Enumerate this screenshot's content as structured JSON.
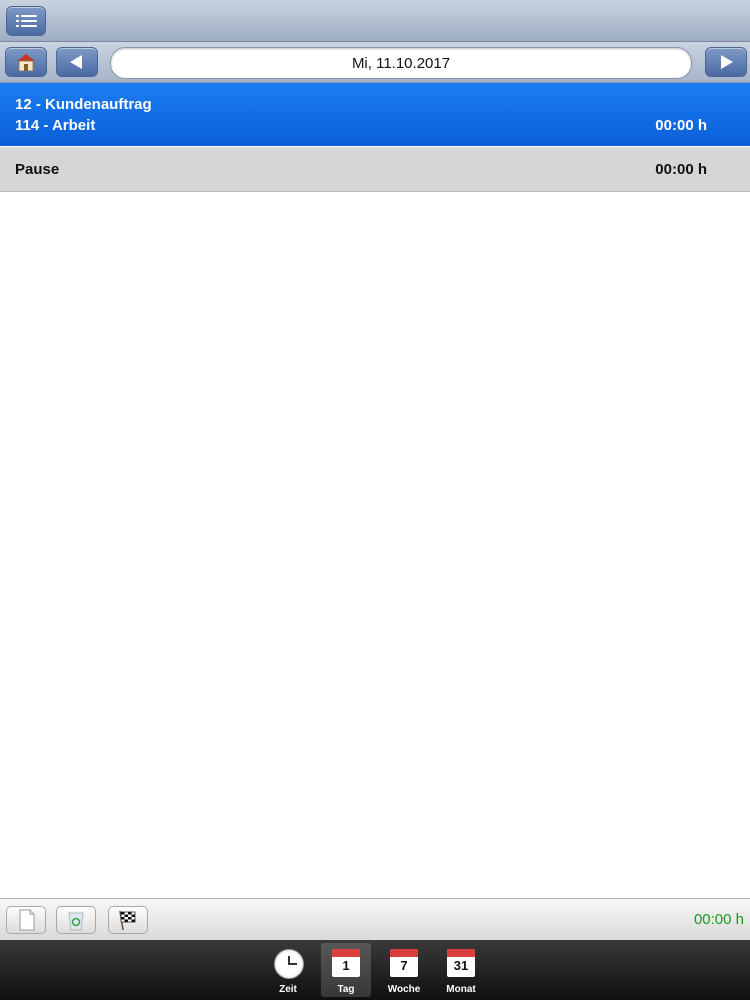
{
  "header": {
    "menu_icon": "list-icon"
  },
  "date_nav": {
    "home_icon": "home-icon",
    "prev_icon": "arrow-left-icon",
    "date": "Mi, 11.10.2017",
    "next_icon": "arrow-right-icon"
  },
  "entries": [
    {
      "line1": "12 - Kundenauftrag",
      "line2": "114 - Arbeit",
      "time": "00:00 h",
      "selected": true
    },
    {
      "line1": "Pause",
      "time": "00:00 h",
      "selected": false
    }
  ],
  "toolbar": {
    "new_icon": "new-document-icon",
    "delete_icon": "recycle-bin-icon",
    "finish_icon": "checkered-flag-icon",
    "total": "00:00 h"
  },
  "tabs": [
    {
      "label": "Zeit",
      "icon": "clock-icon"
    },
    {
      "label": "Tag",
      "icon": "calendar-icon",
      "number": "1",
      "active": true
    },
    {
      "label": "Woche",
      "icon": "calendar-icon",
      "number": "7"
    },
    {
      "label": "Monat",
      "icon": "calendar-icon",
      "number": "31"
    }
  ],
  "colors": {
    "selected_row": "#0a6ae6",
    "pause_row": "#d6d6d6",
    "total_time": "#179c1c"
  }
}
